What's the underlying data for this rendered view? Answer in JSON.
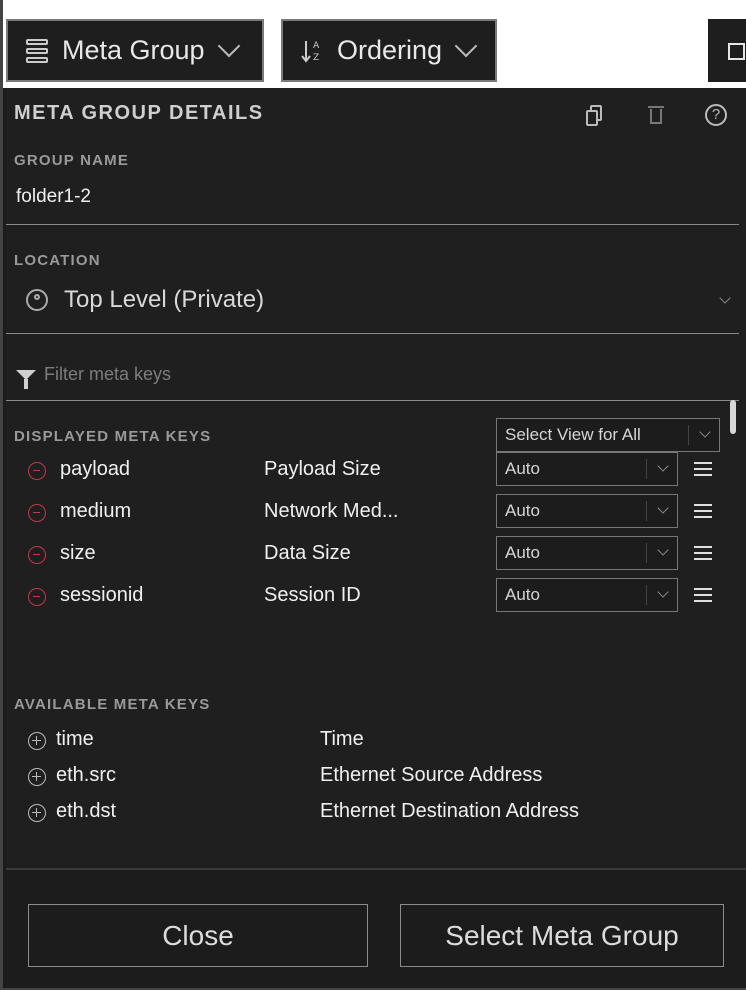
{
  "toolbar": {
    "meta_group_label": "Meta Group",
    "ordering_label": "Ordering"
  },
  "panel": {
    "title": "META GROUP DETAILS",
    "group_name_label": "GROUP NAME",
    "group_name_value": "folder1-2",
    "location_label": "LOCATION",
    "location_value": "Top Level (Private)",
    "filter_placeholder": "Filter meta keys",
    "displayed_label": "DISPLAYED META KEYS",
    "select_view_all": "Select View for All",
    "help_symbol": "?"
  },
  "displayed_keys": [
    {
      "key": "payload",
      "name": "Payload Size",
      "view": "Auto"
    },
    {
      "key": "medium",
      "name": "Network Med...",
      "view": "Auto"
    },
    {
      "key": "size",
      "name": "Data Size",
      "view": "Auto"
    },
    {
      "key": "sessionid",
      "name": "Session ID",
      "view": "Auto"
    }
  ],
  "available_label": "AVAILABLE META KEYS",
  "available_keys": [
    {
      "key": "time",
      "name": "Time"
    },
    {
      "key": "eth.src",
      "name": "Ethernet Source Address"
    },
    {
      "key": "eth.dst",
      "name": "Ethernet Destination Address"
    }
  ],
  "footer": {
    "close_label": "Close",
    "select_label": "Select Meta Group"
  },
  "icons": {
    "meta_group": "stack-icon",
    "ordering": "sort-az-icon",
    "maximize": "maximize-icon",
    "copy": "copy-icon",
    "delete": "trash-icon",
    "help": "help-icon",
    "location": "person-icon",
    "filter": "funnel-icon",
    "remove": "minus-circle-icon",
    "add": "plus-circle-icon",
    "drag": "drag-handle-icon"
  },
  "colors": {
    "background": "#1f1f1f",
    "remove_accent": "#c0394b",
    "text": "#f0f0f0"
  }
}
